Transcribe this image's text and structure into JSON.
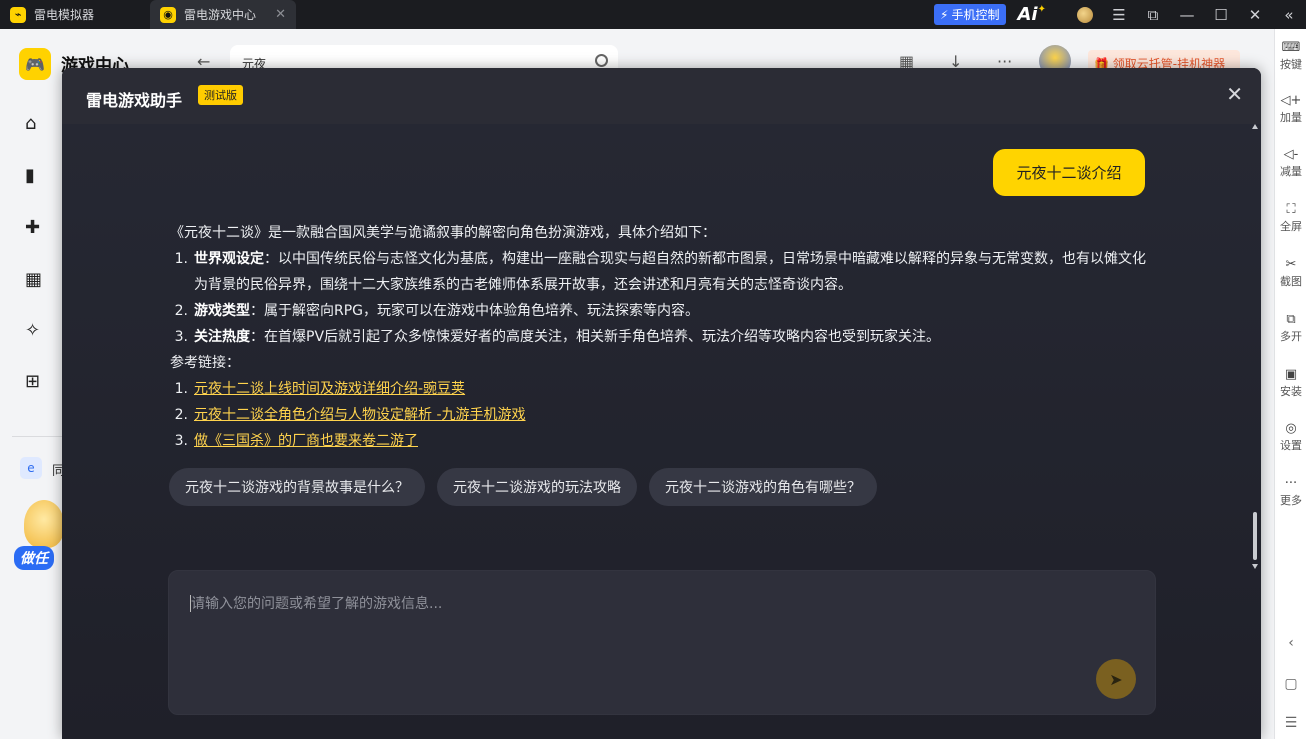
{
  "titlebar": {
    "tabs": [
      {
        "label": "雷电模拟器"
      },
      {
        "label": "雷电游戏中心"
      }
    ],
    "phone_control": "手机控制",
    "ai_label": "Ai"
  },
  "rightbar": {
    "items": [
      {
        "label": "按键",
        "icon": "keyboard-icon"
      },
      {
        "label": "加量",
        "icon": "volume-up-icon"
      },
      {
        "label": "减量",
        "icon": "volume-down-icon"
      },
      {
        "label": "全屏",
        "icon": "fullscreen-icon"
      },
      {
        "label": "截图",
        "icon": "scissors-icon"
      },
      {
        "label": "多开",
        "icon": "multi-instance-icon"
      },
      {
        "label": "安装",
        "icon": "apk-install-icon"
      },
      {
        "label": "设置",
        "icon": "gear-icon"
      },
      {
        "label": "更多",
        "icon": "more-icon"
      }
    ]
  },
  "app": {
    "title": "游戏中心",
    "search_value": "元夜",
    "promo": "领取云托管-挂机神器",
    "side_mini_label": "同",
    "mascot_label": "做任"
  },
  "modal": {
    "title": "雷电游戏助手",
    "badge": "测试版",
    "user_message": "元夜十二谈介绍",
    "answer": {
      "intro": "《元夜十二谈》是一款融合国风美学与诡谲叙事的解密向角色扮演游戏，具体介绍如下：",
      "points": [
        {
          "num": "1.",
          "title": "世界观设定",
          "text": "：以中国传统民俗与志怪文化为基底，构建出一座融合现实与超自然的新都市图景，日常场景中暗藏难以解释的异象与无常变数，也有以傩文化为背景的民俗异界，围绕十二大家族维系的古老傩师体系展开故事，还会讲述和月亮有关的志怪奇谈内容。"
        },
        {
          "num": "2.",
          "title": "游戏类型",
          "text": "：属于解密向RPG，玩家可以在游戏中体验角色培养、玩法探索等内容。"
        },
        {
          "num": "3.",
          "title": "关注热度",
          "text": "：在首爆PV后就引起了众多惊悚爱好者的高度关注，相关新手角色培养、玩法介绍等攻略内容也受到玩家关注。"
        }
      ],
      "refs_label": "参考链接：",
      "refs": [
        {
          "num": "1.",
          "text": "元夜十二谈上线时间及游戏详细介绍-豌豆荚"
        },
        {
          "num": "2.",
          "text": "元夜十二谈全角色介绍与人物设定解析 -九游手机游戏"
        },
        {
          "num": "3.",
          "text": "做《三国杀》的厂商也要来卷二游了"
        }
      ]
    },
    "suggestions": [
      "元夜十二谈游戏的背景故事是什么？",
      "元夜十二谈游戏的玩法攻略",
      "元夜十二谈游戏的角色有哪些？"
    ],
    "input_placeholder": "请输入您的问题或希望了解的游戏信息..."
  },
  "colors": {
    "accent": "#ffd400",
    "modal_bg": "#23242c",
    "link": "#ffd34d"
  }
}
